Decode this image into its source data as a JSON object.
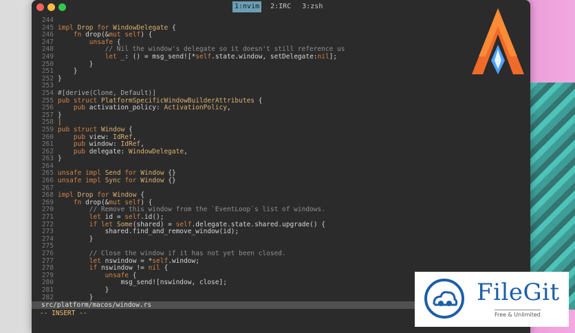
{
  "window": {
    "tabs": [
      {
        "label": "1:nvim",
        "active": true
      },
      {
        "label": "2:IRC",
        "active": false
      },
      {
        "label": "3:zsh",
        "active": false
      }
    ]
  },
  "editor": {
    "lines": [
      {
        "n": "244",
        "code": ""
      },
      {
        "n": "245",
        "code": "impl Drop for WindowDelegate {"
      },
      {
        "n": "246",
        "code": "    fn drop(&mut self) {"
      },
      {
        "n": "247",
        "code": "        unsafe {"
      },
      {
        "n": "248",
        "code": "            // Nil the window's delegate so it doesn't still reference us"
      },
      {
        "n": "249",
        "code": "            let _: () = msg_send![*self.state.window, setDelegate:nil];"
      },
      {
        "n": "250",
        "code": "        }"
      },
      {
        "n": "251",
        "code": "    }"
      },
      {
        "n": "252",
        "code": "}"
      },
      {
        "n": "253",
        "code": ""
      },
      {
        "n": "254",
        "code": "#[derive(Clone, Default)]"
      },
      {
        "n": "255",
        "code": "pub struct PlatformSpecificWindowBuilderAttributes {"
      },
      {
        "n": "256",
        "code": "    pub activation_policy: ActivationPolicy,"
      },
      {
        "n": "257",
        "code": "}"
      },
      {
        "n": "258",
        "code": "|"
      },
      {
        "n": "259",
        "code": "pub struct Window {"
      },
      {
        "n": "260",
        "code": "    pub view: IdRef,"
      },
      {
        "n": "261",
        "code": "    pub window: IdRef,"
      },
      {
        "n": "262",
        "code": "    pub delegate: WindowDelegate,"
      },
      {
        "n": "263",
        "code": "}"
      },
      {
        "n": "264",
        "code": ""
      },
      {
        "n": "265",
        "code": "unsafe impl Send for Window {}"
      },
      {
        "n": "266",
        "code": "unsafe impl Sync for Window {}"
      },
      {
        "n": "267",
        "code": ""
      },
      {
        "n": "268",
        "code": "impl Drop for Window {"
      },
      {
        "n": "269",
        "code": "    fn drop(&mut self) {"
      },
      {
        "n": "270",
        "code": "        // Remove this window from the `EventLoop`s list of windows."
      },
      {
        "n": "271",
        "code": "        let id = self.id();"
      },
      {
        "n": "272",
        "code": "        if let Some(shared) = self.delegate.state.shared.upgrade() {"
      },
      {
        "n": "273",
        "code": "            shared.find_and_remove_window(id);"
      },
      {
        "n": "274",
        "code": "        }"
      },
      {
        "n": "275",
        "code": ""
      },
      {
        "n": "276",
        "code": "        // Close the window if it has not yet been closed."
      },
      {
        "n": "277",
        "code": "        let nswindow = *self.window;"
      },
      {
        "n": "278",
        "code": "        if nswindow != nil {"
      },
      {
        "n": "279",
        "code": "            unsafe {"
      },
      {
        "n": "280",
        "code": "                msg_send![nswindow, close];"
      },
      {
        "n": "281",
        "code": "            }"
      },
      {
        "n": "282",
        "code": "        }"
      }
    ],
    "filepath": "src/platform/macos/window.rs",
    "mode": "-- INSERT --"
  },
  "watermark": {
    "brand": "FileGit",
    "tagline": "Free & Unlimited"
  },
  "colors": {
    "keyword": "#d28445",
    "type": "#ddb26f",
    "comment": "#8f8f8f",
    "insert_mode": "#f4bf75",
    "tab_active_bg": "#6a9fb5",
    "brand_blue": "#1d5ea8"
  }
}
